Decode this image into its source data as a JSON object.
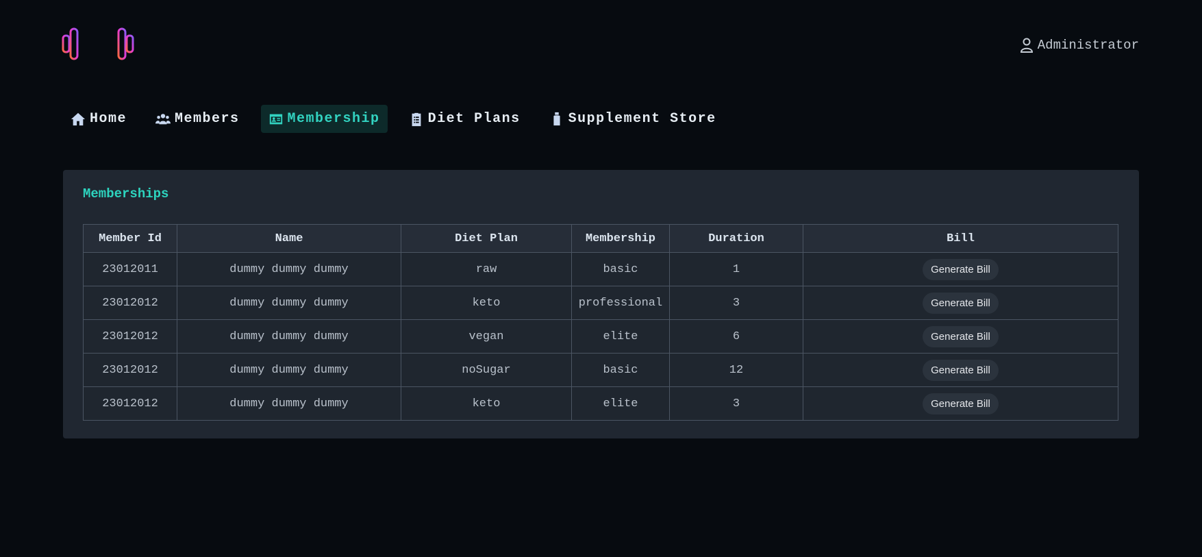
{
  "header": {
    "logo_icon": "dumbbell-icon",
    "user_icon": "user-icon",
    "user_name": "Administrator"
  },
  "nav": [
    {
      "label": "Home",
      "icon": "home-icon",
      "active": false
    },
    {
      "label": "Members",
      "icon": "users-icon",
      "active": false
    },
    {
      "label": "Membership",
      "icon": "id-card-icon",
      "active": true
    },
    {
      "label": "Diet Plans",
      "icon": "clipboard-icon",
      "active": false
    },
    {
      "label": "Supplement Store",
      "icon": "bottle-icon",
      "active": false
    }
  ],
  "card": {
    "title": "Memberships",
    "columns": [
      "Member Id",
      "Name",
      "Diet Plan",
      "Membership",
      "Duration",
      "Bill"
    ],
    "rows": [
      {
        "id": "23012011",
        "name": "dummy dummy dummy",
        "diet": "raw",
        "membership": "basic",
        "duration": "1",
        "bill": "Generate Bill"
      },
      {
        "id": "23012012",
        "name": "dummy dummy dummy",
        "diet": "keto",
        "membership": "professional",
        "duration": "3",
        "bill": "Generate Bill"
      },
      {
        "id": "23012012",
        "name": "dummy dummy dummy",
        "diet": "vegan",
        "membership": "elite",
        "duration": "6",
        "bill": "Generate Bill"
      },
      {
        "id": "23012012",
        "name": "dummy dummy dummy",
        "diet": "noSugar",
        "membership": "basic",
        "duration": "12",
        "bill": "Generate Bill"
      },
      {
        "id": "23012012",
        "name": "dummy dummy dummy",
        "diet": "keto",
        "membership": "elite",
        "duration": "3",
        "bill": "Generate Bill"
      }
    ]
  },
  "colors": {
    "background": "#070b10",
    "card": "#202731",
    "accent": "#2dd4bf",
    "active_nav_bg": "#0d2a2a"
  }
}
